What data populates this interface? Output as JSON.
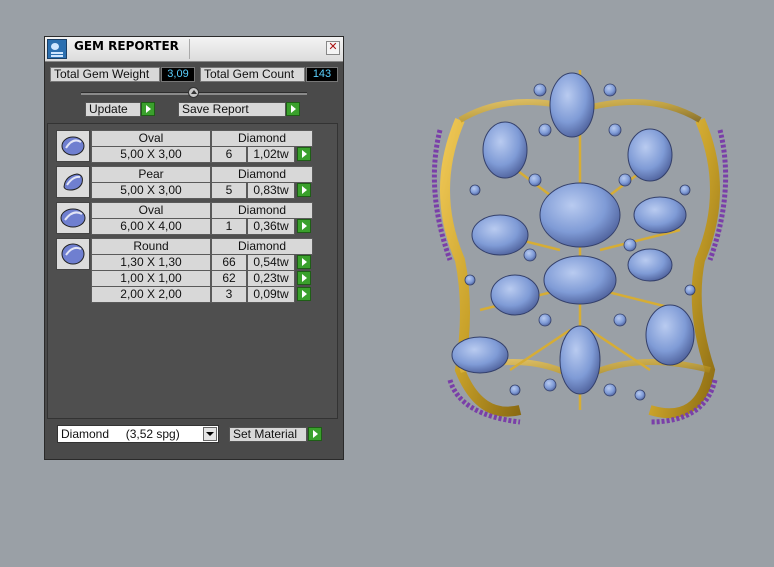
{
  "window": {
    "title": "GEM REPORTER"
  },
  "stats": {
    "total_weight_label": "Total Gem Weight",
    "total_weight_value": "3,09",
    "total_count_label": "Total Gem Count",
    "total_count_value": "143"
  },
  "toolbar": {
    "update_label": "Update",
    "save_report_label": "Save Report"
  },
  "gems": [
    {
      "shape": "Oval",
      "material": "Diamond",
      "rows": [
        {
          "size": "5,00 X 3,00",
          "count": "6",
          "weight": "1,02tw"
        }
      ]
    },
    {
      "shape": "Pear",
      "material": "Diamond",
      "rows": [
        {
          "size": "5,00 X 3,00",
          "count": "5",
          "weight": "0,83tw"
        }
      ]
    },
    {
      "shape": "Oval",
      "material": "Diamond",
      "rows": [
        {
          "size": "6,00 X 4,00",
          "count": "1",
          "weight": "0,36tw"
        }
      ]
    },
    {
      "shape": "Round",
      "material": "Diamond",
      "rows": [
        {
          "size": "1,30 X 1,30",
          "count": "66",
          "weight": "0,54tw"
        },
        {
          "size": "1,00 X 1,00",
          "count": "62",
          "weight": "0,23tw"
        },
        {
          "size": "2,00 X 2,00",
          "count": "3",
          "weight": "0,09tw"
        }
      ]
    }
  ],
  "footer": {
    "material_selected": "Diamond     (3,52 spg)",
    "set_material_label": "Set Material"
  },
  "colors": {
    "panel_bg": "#4a4a4a",
    "value_text": "#5ad0ff",
    "play_green": "#3aa02c",
    "gold": "#c9a22a",
    "gem_blue": "#7f9bd6",
    "gem_purple": "#7a3fa8"
  },
  "icons": [
    "gem-reporter-icon",
    "close-icon",
    "slider-knob-icon",
    "play-icon",
    "gem-thumbnail-icon",
    "dropdown-arrow-icon"
  ]
}
